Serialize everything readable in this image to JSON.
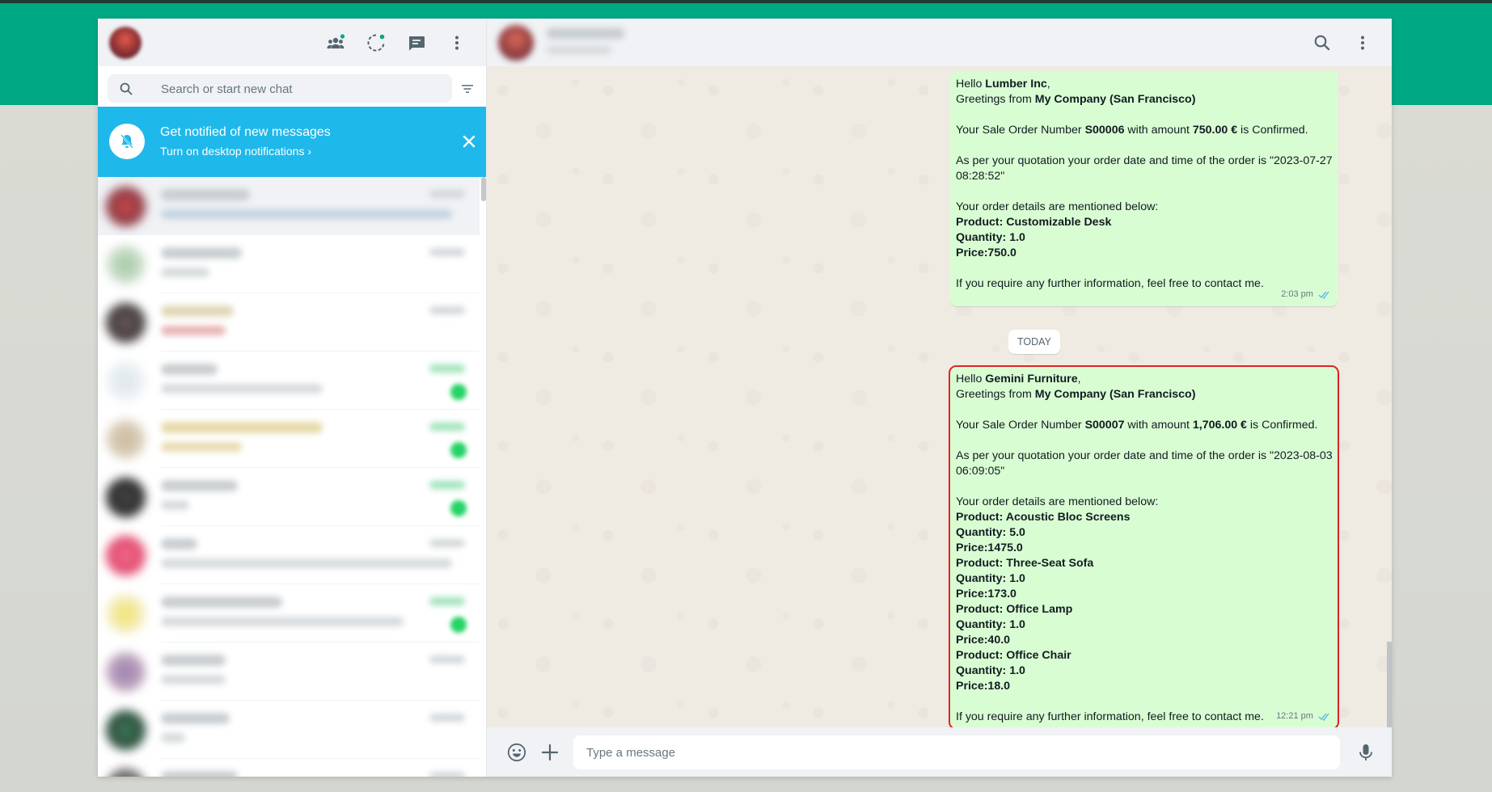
{
  "colors": {
    "brand_green": "#00a884",
    "notif_blue": "#1fb8ea",
    "bubble_out": "#d9fdd3",
    "panel_gray": "#f0f2f5",
    "highlight_outline": "#e02424",
    "read_ticks": "#53bdeb"
  },
  "left_header": {
    "icons": [
      "communities-icon",
      "status-icon",
      "new-chat-icon",
      "menu-icon"
    ]
  },
  "search": {
    "placeholder": "Search or start new chat"
  },
  "notification": {
    "title": "Get notified of new messages",
    "link": "Turn on desktop notifications ›"
  },
  "conversation": {
    "day_separator": "TODAY",
    "composer_placeholder": "Type a message",
    "messages": [
      {
        "time": "2:03 pm",
        "status": "read",
        "lines": [
          {
            "t": "Hello ",
            "b": "Lumber Inc",
            "a": ","
          },
          {
            "t": "Greetings from ",
            "b": "My Company (San Francisco)",
            "a": ""
          },
          {
            "t": "",
            "b": "",
            "a": ""
          },
          {
            "t": "Your Sale Order Number ",
            "b": "S00006",
            "a": " with amount ",
            "b2": "750.00 €",
            "a2": " is Confirmed."
          },
          {
            "t": "",
            "b": "",
            "a": ""
          },
          {
            "t": "As per your quotation your order date and time of the order is \"2023-07-27",
            "b": "",
            "a": ""
          },
          {
            "t": "08:28:52\"",
            "b": "",
            "a": ""
          },
          {
            "t": "",
            "b": "",
            "a": ""
          },
          {
            "t": "Your order details are mentioned below:",
            "b": "",
            "a": ""
          },
          {
            "t": "",
            "b": "Product: Customizable Desk",
            "a": ""
          },
          {
            "t": "",
            "b": "Quantity: 1.0",
            "a": ""
          },
          {
            "t": "",
            "b": "Price:750.0",
            "a": ""
          },
          {
            "t": "",
            "b": "",
            "a": ""
          },
          {
            "t": "If you require any further information, feel free to contact me.",
            "b": "",
            "a": ""
          }
        ]
      },
      {
        "time": "12:21 pm",
        "status": "read",
        "lines": [
          {
            "t": "Hello ",
            "b": "Gemini Furniture",
            "a": ","
          },
          {
            "t": "Greetings from ",
            "b": "My Company (San Francisco)",
            "a": ""
          },
          {
            "t": "",
            "b": "",
            "a": ""
          },
          {
            "t": "Your Sale Order Number ",
            "b": "S00007",
            "a": " with amount ",
            "b2": "1,706.00 €",
            "a2": " is Confirmed."
          },
          {
            "t": "",
            "b": "",
            "a": ""
          },
          {
            "t": "As per your quotation your order date and time of the order is \"2023-08-03",
            "b": "",
            "a": ""
          },
          {
            "t": "06:09:05\"",
            "b": "",
            "a": ""
          },
          {
            "t": "",
            "b": "",
            "a": ""
          },
          {
            "t": "Your order details are mentioned below:",
            "b": "",
            "a": ""
          },
          {
            "t": "",
            "b": "Product: Acoustic Bloc Screens",
            "a": ""
          },
          {
            "t": "",
            "b": "Quantity: 5.0",
            "a": ""
          },
          {
            "t": "",
            "b": "Price:1475.0",
            "a": ""
          },
          {
            "t": "",
            "b": "Product: Three-Seat Sofa",
            "a": ""
          },
          {
            "t": "",
            "b": "Quantity: 1.0",
            "a": ""
          },
          {
            "t": "",
            "b": "Price:173.0",
            "a": ""
          },
          {
            "t": "",
            "b": "Product: Office Lamp",
            "a": ""
          },
          {
            "t": "",
            "b": "Quantity: 1.0",
            "a": ""
          },
          {
            "t": "",
            "b": "Price:40.0",
            "a": ""
          },
          {
            "t": "",
            "b": "Product: Office Chair",
            "a": ""
          },
          {
            "t": "",
            "b": "Quantity: 1.0",
            "a": ""
          },
          {
            "t": "",
            "b": "Price:18.0",
            "a": ""
          },
          {
            "t": "",
            "b": "",
            "a": ""
          },
          {
            "t": "If you require any further information, feel free to contact me.",
            "b": "",
            "a": ""
          }
        ]
      }
    ]
  }
}
